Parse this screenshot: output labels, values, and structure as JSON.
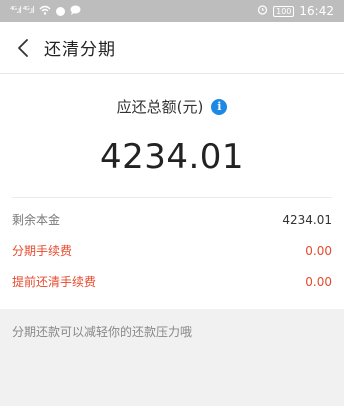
{
  "status_bar": {
    "left_signal": "⁴ᴳ.ıl ⁴ᴳ.ıl",
    "right_battery": "100",
    "time": "16:42"
  },
  "nav": {
    "title": "还清分期"
  },
  "summary": {
    "total_label": "应还总额(元)",
    "total_amount": "4234.01"
  },
  "details": [
    {
      "label": "剩余本金",
      "value": "4234.01"
    },
    {
      "label": "分期手续费",
      "value": "0.00"
    },
    {
      "label": "提前还清手续费",
      "value": "0.00"
    }
  ],
  "footer": {
    "note": "分期还款可以减轻你的还款压力哦"
  }
}
